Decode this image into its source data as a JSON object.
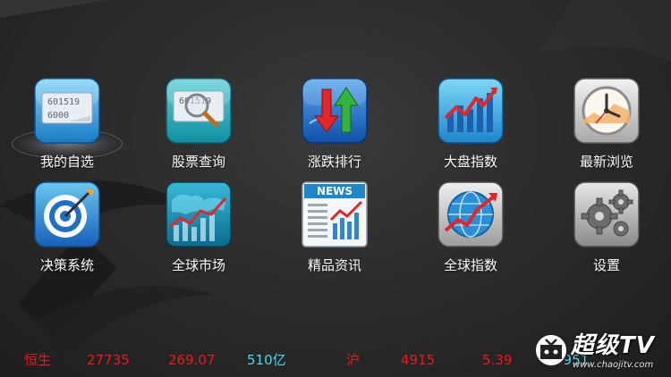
{
  "tiles": [
    {
      "label": "我的自选",
      "icon": "watchlist-icon",
      "selected": true,
      "icon_text": [
        "601519",
        "6000"
      ]
    },
    {
      "label": "股票查询",
      "icon": "stock-search-icon",
      "selected": false,
      "icon_text": [
        "601519"
      ]
    },
    {
      "label": "涨跌排行",
      "icon": "up-down-ranking-icon",
      "selected": false
    },
    {
      "label": "大盘指数",
      "icon": "market-index-icon",
      "selected": false
    },
    {
      "label": "最新浏览",
      "icon": "recent-browse-clock-icon",
      "selected": false
    },
    {
      "label": "决策系统",
      "icon": "target-icon",
      "selected": false
    },
    {
      "label": "全球市场",
      "icon": "world-map-chart-icon",
      "selected": false
    },
    {
      "label": "精品资讯",
      "icon": "news-icon",
      "selected": false,
      "icon_text": [
        "NEWS"
      ]
    },
    {
      "label": "全球指数",
      "icon": "globe-chart-icon",
      "selected": false
    },
    {
      "label": "设置",
      "icon": "gears-icon",
      "selected": false
    }
  ],
  "ticker": {
    "hs_name": "恒生",
    "hs_value": "27735",
    "hs_change": "269.07",
    "hs_volume": "510亿",
    "sh_name": "沪",
    "sh_value": "4915",
    "sh_change": "5.39",
    "sh_volume": "6951"
  },
  "watermark": {
    "title": "超级TV",
    "url": "www.chaojitv.com"
  },
  "colors": {
    "ticker_red": "#e8191e",
    "ticker_cyan": "#4fd6ec",
    "background": "#2c2c2c"
  }
}
